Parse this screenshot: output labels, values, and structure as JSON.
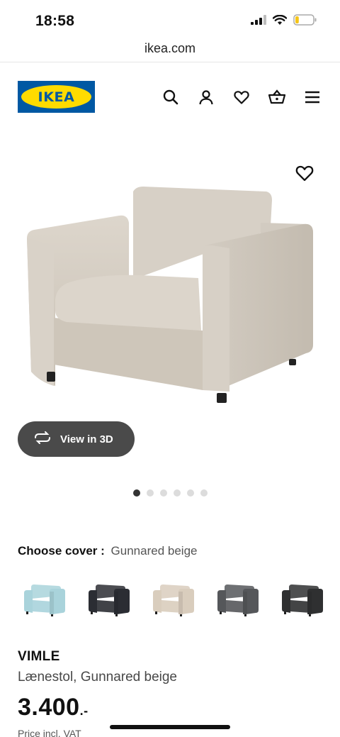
{
  "status_bar": {
    "time": "18:58",
    "battery_level": 0.2
  },
  "browser": {
    "url": "ikea.com"
  },
  "header": {
    "logo_text": "IKEA",
    "icons": [
      "search-icon",
      "account-icon",
      "favourites-icon",
      "basket-icon",
      "menu-icon"
    ]
  },
  "product_image": {
    "view_3d_label": "View in 3D",
    "dots_total": 6,
    "dots_active_index": 0
  },
  "cover": {
    "label": "Choose cover :",
    "value": "Gunnared beige",
    "swatch_colors": [
      "#a9d3db",
      "#2b2d33",
      "#d9cdbd",
      "#55575a",
      "#2f3031"
    ]
  },
  "product": {
    "name": "VIMLE",
    "description": "Lænestol, Gunnared beige",
    "price": "3.400",
    "price_suffix": ".-",
    "price_note": "Price incl. VAT"
  },
  "colors": {
    "brand_blue": "#0058a3",
    "brand_yellow": "#ffdb00"
  }
}
